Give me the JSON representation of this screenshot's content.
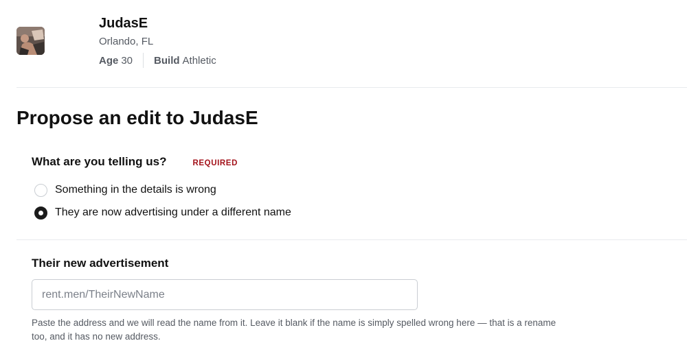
{
  "profile": {
    "name": "JudasE",
    "location": "Orlando, FL",
    "stats": [
      {
        "key": "Age",
        "value": "30"
      },
      {
        "key": "Build",
        "value": "Athletic"
      }
    ]
  },
  "form": {
    "title": "Propose an edit to JudasE",
    "question": {
      "label": "What are you telling us?",
      "required_badge": "REQUIRED",
      "options": [
        {
          "label": "Something in the details is wrong",
          "selected": false
        },
        {
          "label": "They are now advertising under a different name",
          "selected": true
        }
      ]
    },
    "advertisement": {
      "label": "Their new advertisement",
      "value": "",
      "placeholder": "rent.men/TheirNewName",
      "help": "Paste the address and we will read the name from it. Leave it blank if the name is simply spelled wrong here — that is a rename too, and it has no new address."
    }
  },
  "colors": {
    "required": "#a3121a",
    "radio_checked": "#1b1b1b",
    "muted_text": "#555a62",
    "divider": "#e8eaed"
  }
}
